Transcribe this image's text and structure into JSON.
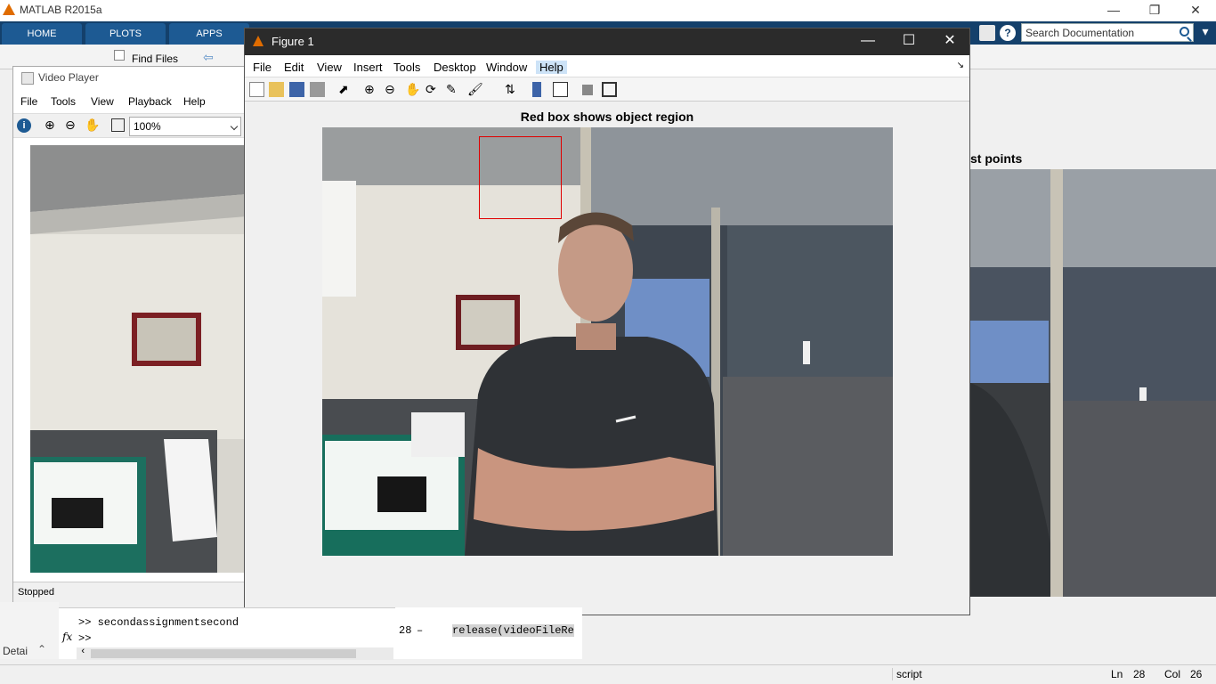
{
  "app": {
    "title": "MATLAB R2015a",
    "accent": "#14406b",
    "brand_color": "#e06c00"
  },
  "ribbon": {
    "tabs": [
      "HOME",
      "PLOTS",
      "APPS"
    ],
    "search_placeholder": "Search Documentation"
  },
  "toolstrip": {
    "find_files": "Find Files"
  },
  "video_player": {
    "title": "Video Player",
    "menu": [
      "File",
      "Tools",
      "View",
      "Playback",
      "Help"
    ],
    "zoom": "100%",
    "status": "Stopped"
  },
  "figure": {
    "title": "Figure 1",
    "menu": [
      "File",
      "Edit",
      "View",
      "Insert",
      "Tools",
      "Desktop",
      "Window",
      "Help"
    ],
    "axes_title": "Red box shows object region",
    "roi_color": "#e00000"
  },
  "right_figure": {
    "title_fragment": "st points"
  },
  "command_window": {
    "history": ">> secondassignmentsecond",
    "prompt": ">>",
    "fx": "fx"
  },
  "editor": {
    "line_number": "28",
    "line_dash": "–",
    "code": "release(videoFileRe"
  },
  "left_rail": {
    "label": "Detai"
  },
  "statusbar": {
    "mode": "script",
    "ln_label": "Ln",
    "ln": "28",
    "col_label": "Col",
    "col": "26"
  }
}
